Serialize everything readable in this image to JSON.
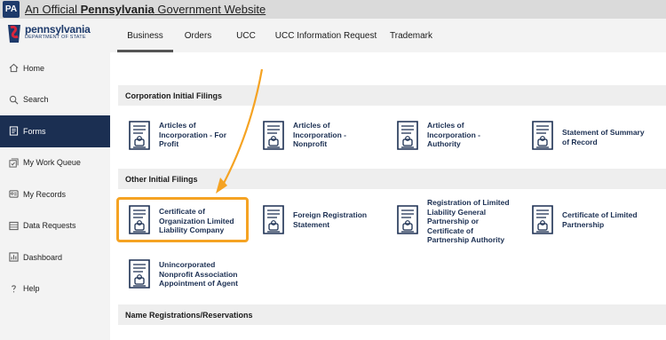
{
  "gov_bar": {
    "badge": "PA",
    "prefix": "An Official ",
    "state": "Pennsylvania",
    "suffix": " Government Website"
  },
  "logo": {
    "name": "pennsylvania",
    "dept": "DEPARTMENT OF STATE"
  },
  "tabs": [
    {
      "label": "Business",
      "active": true
    },
    {
      "label": "Orders"
    },
    {
      "label": "UCC"
    },
    {
      "label": "UCC Information Request"
    },
    {
      "label": "Trademark"
    }
  ],
  "sidebar": {
    "items": [
      {
        "label": "Home",
        "icon": "home-icon"
      },
      {
        "label": "Search",
        "icon": "search-icon"
      },
      {
        "label": "Forms",
        "icon": "forms-icon",
        "active": true
      },
      {
        "label": "My Work Queue",
        "icon": "work-queue-icon"
      },
      {
        "label": "My Records",
        "icon": "records-icon"
      },
      {
        "label": "Data Requests",
        "icon": "data-requests-icon"
      },
      {
        "label": "Dashboard",
        "icon": "dashboard-icon"
      },
      {
        "label": "Help",
        "icon": "help-icon"
      }
    ]
  },
  "sections": {
    "corporation": {
      "title": "Corporation Initial Filings",
      "cards": [
        {
          "line1": "Articles of",
          "line2": "Incorporation - For",
          "line3": "Profit"
        },
        {
          "line1": "Articles of",
          "line2": "Incorporation -",
          "line3": "Nonprofit"
        },
        {
          "line1": "Articles of",
          "line2": "Incorporation -",
          "line3": "Authority"
        },
        {
          "line1": "Statement of Summary",
          "line2": "of Record",
          "line3": ""
        }
      ]
    },
    "other": {
      "title": "Other Initial Filings",
      "cards": [
        {
          "line1": "Certificate of",
          "line2": "Organization Limited",
          "line3": "Liability Company",
          "line4": ""
        },
        {
          "line1": "Foreign Registration",
          "line2": "Statement",
          "line3": "",
          "line4": ""
        },
        {
          "line1": "Registration of Limited",
          "line2": "Liability General",
          "line3": "Partnership or",
          "line4": "Certificate of",
          "line5": "Partnership Authority"
        },
        {
          "line1": "Certificate of Limited",
          "line2": "Partnership",
          "line3": "",
          "line4": ""
        },
        {
          "line1": "Unincorporated",
          "line2": "Nonprofit Association",
          "line3": "Appointment of Agent",
          "line4": ""
        }
      ]
    },
    "name": {
      "title": "Name Registrations/Reservations"
    }
  },
  "colors": {
    "navy": "#1b2f52",
    "highlight": "#f5a323",
    "sidebar_bg": "#f3f3f3",
    "section_bg": "#eeeeee"
  }
}
